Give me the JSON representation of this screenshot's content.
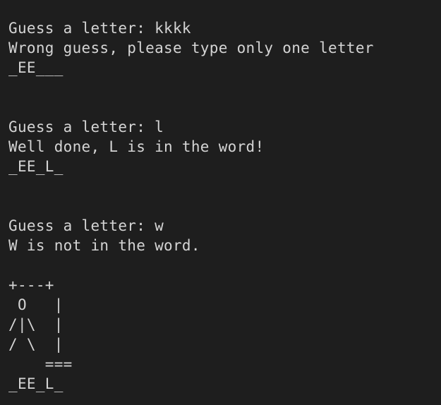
{
  "terminal": {
    "text_color": "#d4d4d4",
    "background_color": "#1e1e1e",
    "round1": {
      "prompt": "Guess a letter: kkkk",
      "message": "Wrong guess, please type only one letter",
      "word": "_EE___"
    },
    "round2": {
      "prompt": "Guess a letter: l",
      "message": "Well done, L is in the word!",
      "word": "_EE_L_"
    },
    "round3": {
      "prompt": "Guess a letter: w",
      "message": "W is not in the word.",
      "gallows": [
        "+---+",
        " O   |",
        "/|\\  |",
        "/ \\  |",
        "    ==="
      ],
      "word": "_EE_L_"
    }
  }
}
